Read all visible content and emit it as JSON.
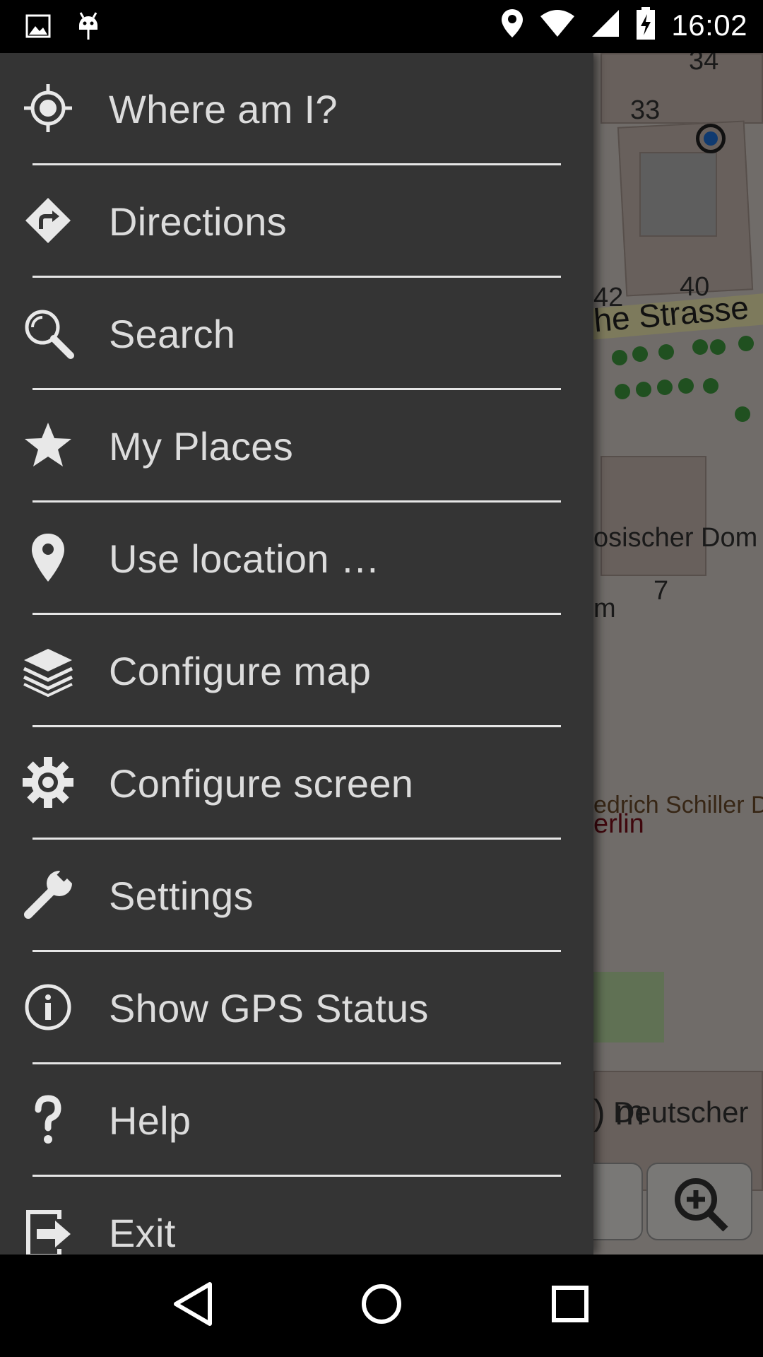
{
  "status_bar": {
    "time": "16:02",
    "icons_left": [
      "image-icon",
      "android-debug-icon"
    ],
    "icons_right": [
      "location-pin-icon",
      "wifi-icon",
      "cell-signal-icon",
      "battery-charging-icon"
    ]
  },
  "map": {
    "house_numbers": [
      "34",
      "33",
      "42",
      "40",
      "7"
    ],
    "street_name": "he Strasse",
    "poi_labels": [
      "osischer Dom",
      "m",
      "edrich Schiller D",
      "erlin",
      ") m",
      "Deutscher"
    ]
  },
  "menu": {
    "items": [
      {
        "label": "Where am I?",
        "icon": "crosshair-location-icon"
      },
      {
        "label": "Directions",
        "icon": "directions-icon"
      },
      {
        "label": "Search",
        "icon": "search-icon"
      },
      {
        "label": "My Places",
        "icon": "star-icon"
      },
      {
        "label": "Use location …",
        "icon": "location-pin-icon"
      },
      {
        "label": "Configure map",
        "icon": "layers-icon"
      },
      {
        "label": "Configure screen",
        "icon": "gear-icon"
      },
      {
        "label": "Settings",
        "icon": "wrench-icon"
      },
      {
        "label": "Show GPS Status",
        "icon": "info-icon"
      },
      {
        "label": "Help",
        "icon": "question-icon"
      },
      {
        "label": "Exit",
        "icon": "exit-icon"
      }
    ]
  },
  "nav_bar": {
    "buttons": [
      "back-icon",
      "home-icon",
      "recents-icon"
    ]
  },
  "colors": {
    "drawer_bg": "#343434",
    "menu_text": "#dcdcdc",
    "divider": "#e6e6e6"
  }
}
